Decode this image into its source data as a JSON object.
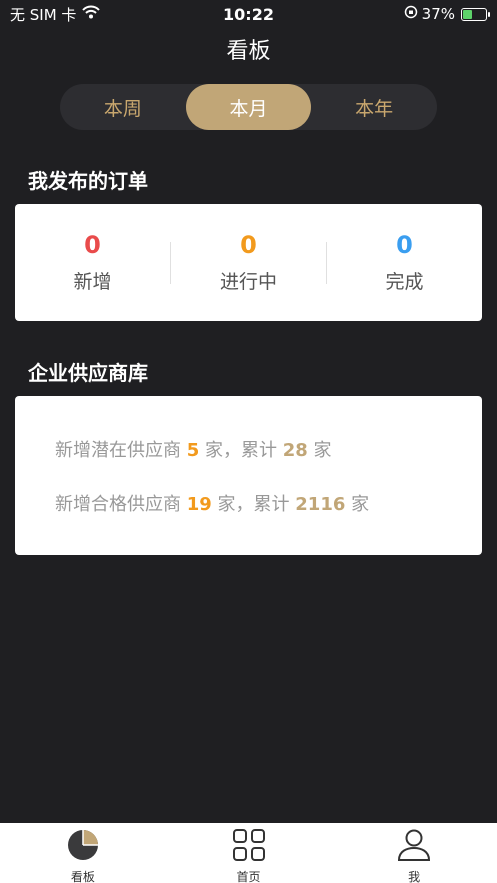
{
  "status_bar": {
    "carrier": "无 SIM 卡",
    "time": "10:22",
    "battery": "37%"
  },
  "nav": {
    "title": "看板"
  },
  "segments": [
    {
      "label": "本周",
      "active": false
    },
    {
      "label": "本月",
      "active": true
    },
    {
      "label": "本年",
      "active": false
    }
  ],
  "orders": {
    "title": "我发布的订单",
    "stats": [
      {
        "value": "0",
        "label": "新增",
        "color": "#e94b4b"
      },
      {
        "value": "0",
        "label": "进行中",
        "color": "#f29a1d"
      },
      {
        "value": "0",
        "label": "完成",
        "color": "#3a9ef0"
      }
    ]
  },
  "suppliers": {
    "title": "企业供应商库",
    "line1": {
      "prefix": "新增潜在供应商",
      "count": "5",
      "mid": "家，累计",
      "total": "28",
      "suffix": "家"
    },
    "line2": {
      "prefix": "新增合格供应商",
      "count": "19",
      "mid": "家，累计",
      "total": "2116",
      "suffix": "家"
    }
  },
  "tab_bar": {
    "items": [
      {
        "label": "看板",
        "icon": "pie-chart-icon"
      },
      {
        "label": "首页",
        "icon": "grid-icon"
      },
      {
        "label": "我",
        "icon": "person-icon"
      }
    ]
  }
}
